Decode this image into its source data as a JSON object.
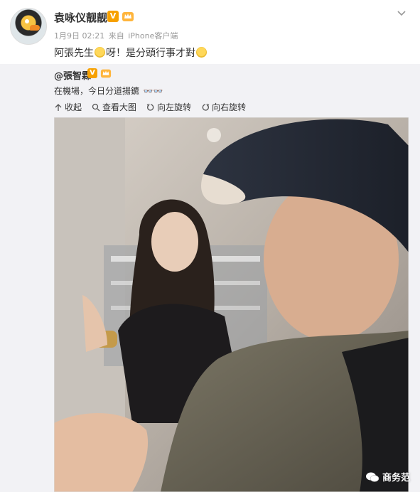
{
  "post": {
    "username": "袁咏仪靓靓",
    "verified_badge": "V",
    "date": "1月9日 02:21",
    "source_prefix": "来自",
    "source": "iPhone客户端",
    "text_part1": "阿張先生",
    "text_part2": "呀！是分頭行事才對",
    "more_icon": "chevron-down-icon"
  },
  "repost": {
    "author": "@張智霖",
    "verified_badge": "V",
    "text": "在機場，今日分道揚鑣",
    "actions": [
      {
        "icon": "collapse-up-icon",
        "label": "收起"
      },
      {
        "icon": "zoom-in-icon",
        "label": "查看大图"
      },
      {
        "icon": "rotate-left-icon",
        "label": "向左旋转"
      },
      {
        "icon": "rotate-right-icon",
        "label": "向右旋转"
      }
    ],
    "photo_description_icon": "selfie-photo"
  },
  "watermark": {
    "label": "商务范",
    "icon": "wechat-icon"
  }
}
